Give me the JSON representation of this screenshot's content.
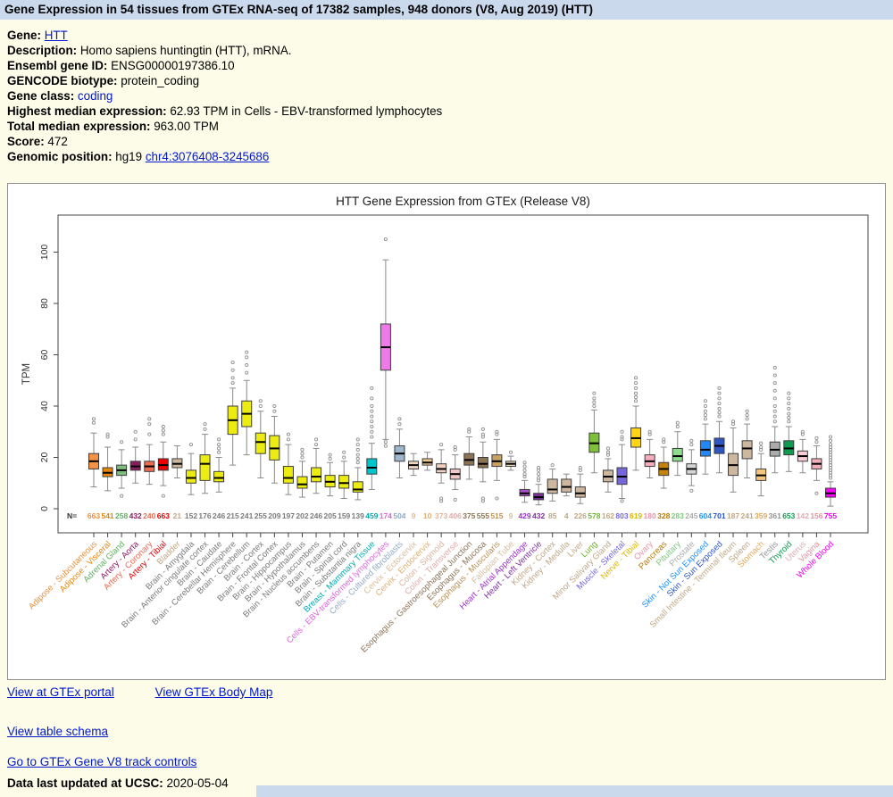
{
  "page": {
    "header": "Gene Expression in 54 tissues from GTEx RNA-seq of 17382 samples, 948 donors (V8, Aug 2019) (HTT)"
  },
  "info": {
    "rows": [
      {
        "label": "Gene:",
        "link": "HTT"
      },
      {
        "label": "Description:",
        "value": "Homo sapiens huntingtin (HTT), mRNA."
      },
      {
        "label": "Ensembl gene ID:",
        "value": "ENSG00000197386.10"
      },
      {
        "label": "GENCODE biotype:",
        "value": "protein_coding"
      },
      {
        "label": "Gene class:",
        "link": "coding"
      },
      {
        "label": "Highest median expression:",
        "value": "62.93 TPM in Cells - EBV-transformed lymphocytes"
      },
      {
        "label": "Total median expression:",
        "value": "963.00 TPM"
      },
      {
        "label": "Score:",
        "value": "472"
      },
      {
        "label": "Genomic position:",
        "value": "hg19",
        "link": "chr4:3076408-3245686"
      }
    ]
  },
  "links": {
    "portal": "View at GTEx portal",
    "bodymap": "View GTEx Body Map",
    "schema": "View table schema",
    "controls": "Go to GTEx Gene V8 track controls"
  },
  "footer": {
    "label": "Data last updated at UCSC:",
    "value": "2020-05-04"
  },
  "chart_data": {
    "type": "boxplot",
    "title": "HTT Gene Expression from GTEx (Release V8)",
    "ylabel": "TPM",
    "yticks": [
      0,
      20,
      40,
      60,
      80,
      100
    ],
    "ylim": [
      0,
      110
    ],
    "n_label": "N=",
    "brain_label_color": "#7a7a7a",
    "tissues": [
      {
        "name": "Adipose - Subcutaneous",
        "n": 663,
        "color": "#f59245",
        "label_color": "#e8903f",
        "q1": 15.5,
        "median": 18.5,
        "q3": 21.5,
        "wlow": 8.5,
        "whigh": 29.5,
        "outliers": [
          33.5,
          35
        ]
      },
      {
        "name": "Adipose - Visceral",
        "n": 541,
        "color": "#e7860e",
        "label_color": "#e7860e",
        "q1": 12.5,
        "median": 14,
        "q3": 16,
        "wlow": 7,
        "whigh": 24,
        "outliers": [
          28,
          29
        ]
      },
      {
        "name": "Adrenal Gland",
        "n": 258,
        "color": "#7ebe7e",
        "label_color": "#5fae5f",
        "q1": 13,
        "median": 15,
        "q3": 17,
        "wlow": 8,
        "whigh": 23,
        "outliers": [
          26,
          5
        ]
      },
      {
        "name": "Artery - Aorta",
        "n": 432,
        "color": "#8b1c62",
        "label_color": "#8b1c62",
        "q1": 15,
        "median": 16.5,
        "q3": 18.5,
        "wlow": 10,
        "whigh": 24,
        "outliers": [
          27,
          30
        ]
      },
      {
        "name": "Artery - Coronary",
        "n": 240,
        "color": "#ee6a50",
        "label_color": "#ee6a50",
        "q1": 14.5,
        "median": 16.5,
        "q3": 18.5,
        "wlow": 9.5,
        "whigh": 25,
        "outliers": [
          29,
          33,
          35
        ]
      },
      {
        "name": "Artery - Tibial",
        "n": 663,
        "color": "#ee0000",
        "label_color": "#dd0000",
        "q1": 15,
        "median": 17,
        "q3": 19.5,
        "wlow": 9,
        "whigh": 26,
        "outliers": [
          29,
          30.5,
          32,
          5
        ]
      },
      {
        "name": "Bladder",
        "n": 21,
        "color": "#cdb79e",
        "label_color": "#c0a683",
        "q1": 16,
        "median": 17.5,
        "q3": 19.5,
        "wlow": 12,
        "whigh": 24.5,
        "outliers": []
      },
      {
        "name": "Brain - Amygdala",
        "n": 152,
        "color": "#ecec13",
        "label_color": "#7a7a7a",
        "q1": 10,
        "median": 12,
        "q3": 15,
        "wlow": 5.5,
        "whigh": 21.5,
        "outliers": [
          25
        ]
      },
      {
        "name": "Brain - Anterior cingulate cortex",
        "n": 176,
        "color": "#ecec13",
        "label_color": "#7a7a7a",
        "q1": 11,
        "median": 17.5,
        "q3": 21,
        "wlow": 6,
        "whigh": 29,
        "outliers": [
          31,
          33
        ]
      },
      {
        "name": "Brain - Caudate",
        "n": 246,
        "color": "#ecec13",
        "label_color": "#7a7a7a",
        "q1": 10.5,
        "median": 12,
        "q3": 14.5,
        "wlow": 6.5,
        "whigh": 20,
        "outliers": [
          22,
          23.5,
          25,
          27
        ]
      },
      {
        "name": "Brain - Cerebellar Hemisphere",
        "n": 215,
        "color": "#ecec13",
        "label_color": "#7a7a7a",
        "q1": 29,
        "median": 34.5,
        "q3": 40,
        "wlow": 17,
        "whigh": 47,
        "outliers": [
          49,
          51,
          54,
          57
        ]
      },
      {
        "name": "Brain - Cerebellum",
        "n": 241,
        "color": "#ecec13",
        "label_color": "#7a7a7a",
        "q1": 32,
        "median": 37,
        "q3": 42,
        "wlow": 21,
        "whigh": 50,
        "outliers": [
          53,
          56,
          59,
          61
        ]
      },
      {
        "name": "Brain - Cortex",
        "n": 255,
        "color": "#ecec13",
        "label_color": "#7a7a7a",
        "q1": 21.5,
        "median": 26,
        "q3": 29.5,
        "wlow": 12,
        "whigh": 38,
        "outliers": [
          40,
          42
        ]
      },
      {
        "name": "Brain - Frontal Cortex",
        "n": 209,
        "color": "#ecec13",
        "label_color": "#7a7a7a",
        "q1": 19,
        "median": 23.5,
        "q3": 28.5,
        "wlow": 10,
        "whigh": 36,
        "outliers": [
          38,
          40
        ]
      },
      {
        "name": "Brain - Hippocampus",
        "n": 197,
        "color": "#ecec13",
        "label_color": "#7a7a7a",
        "q1": 10,
        "median": 12,
        "q3": 16.5,
        "wlow": 5.5,
        "whigh": 25,
        "outliers": [
          27,
          29
        ]
      },
      {
        "name": "Brain - Hypothalamus",
        "n": 202,
        "color": "#ecec13",
        "label_color": "#7a7a7a",
        "q1": 8,
        "median": 9.5,
        "q3": 12.5,
        "wlow": 4.5,
        "whigh": 18.5,
        "outliers": [
          20,
          21.5,
          23
        ]
      },
      {
        "name": "Brain - Nucleus accumbens",
        "n": 246,
        "color": "#ecec13",
        "label_color": "#7a7a7a",
        "q1": 10.5,
        "median": 12.5,
        "q3": 16,
        "wlow": 6,
        "whigh": 23.5,
        "outliers": [
          25,
          27
        ]
      },
      {
        "name": "Brain - Putamen",
        "n": 205,
        "color": "#ecec13",
        "label_color": "#7a7a7a",
        "q1": 8.5,
        "median": 10.5,
        "q3": 13,
        "wlow": 5,
        "whigh": 18,
        "outliers": [
          19.5,
          21
        ]
      },
      {
        "name": "Brain - Spinal cord",
        "n": 159,
        "color": "#ecec13",
        "label_color": "#7a7a7a",
        "q1": 8,
        "median": 10,
        "q3": 13,
        "wlow": 4,
        "whigh": 18.5,
        "outliers": [
          20,
          22
        ]
      },
      {
        "name": "Brain - Substantia nigra",
        "n": 139,
        "color": "#ecec13",
        "label_color": "#7a7a7a",
        "q1": 6.5,
        "median": 7.5,
        "q3": 10.5,
        "wlow": 3.5,
        "whigh": 16,
        "outliers": [
          18,
          19.5,
          21,
          23,
          25,
          27
        ]
      },
      {
        "name": "Breast - Mammary Tissue",
        "n": 459,
        "color": "#00c5cd",
        "label_color": "#00aab2",
        "q1": 13.5,
        "median": 16,
        "q3": 19.5,
        "wlow": 7.5,
        "whigh": 25.5,
        "outliers": [
          28,
          30,
          32,
          34,
          36,
          38,
          40,
          43,
          47
        ]
      },
      {
        "name": "Cells - EBV-transformed lymphocytes",
        "n": 174,
        "color": "#ee7ae9",
        "label_color": "#dd66dd",
        "q1": 54,
        "median": 62.93,
        "q3": 72,
        "wlow": 27,
        "whigh": 97,
        "outliers": [
          24.5,
          26,
          105
        ]
      },
      {
        "name": "Cells - Cultured fibroblasts",
        "n": 504,
        "color": "#9fb6cd",
        "label_color": "#92aac4",
        "q1": 18.5,
        "median": 21.5,
        "q3": 24.5,
        "wlow": 12,
        "whigh": 31,
        "outliers": [
          33,
          35
        ]
      },
      {
        "name": "Cervix - Ectocervix",
        "n": 9,
        "color": "#eed7c0",
        "label_color": "#d9bc9c",
        "q1": 15.5,
        "median": 17,
        "q3": 18.5,
        "wlow": 13,
        "whigh": 21.5,
        "outliers": []
      },
      {
        "name": "Cervix - Endocervix",
        "n": 10,
        "color": "#eec591",
        "label_color": "#dfae6f",
        "q1": 17,
        "median": 18,
        "q3": 19.5,
        "wlow": 15,
        "whigh": 22,
        "outliers": []
      },
      {
        "name": "Colon - Sigmoid",
        "n": 373,
        "color": "#eed0c0",
        "label_color": "#ddb49e",
        "q1": 14,
        "median": 15.5,
        "q3": 17.5,
        "wlow": 10,
        "whigh": 23,
        "outliers": [
          25,
          4,
          3
        ]
      },
      {
        "name": "Colon - Transverse",
        "n": 406,
        "color": "#f0c8c8",
        "label_color": "#dfa9a9",
        "q1": 11.5,
        "median": 13.5,
        "q3": 15.5,
        "wlow": 7.5,
        "whigh": 21,
        "outliers": [
          23,
          24,
          3.5
        ]
      },
      {
        "name": "Esophagus - Gastroesophageal Junction",
        "n": 375,
        "color": "#8b7355",
        "label_color": "#8b7355",
        "q1": 17,
        "median": 19,
        "q3": 21.5,
        "wlow": 11.5,
        "whigh": 28,
        "outliers": [
          30,
          31
        ]
      },
      {
        "name": "Esophagus - Mucosa",
        "n": 555,
        "color": "#8b7355",
        "label_color": "#8b7355",
        "q1": 16,
        "median": 17.5,
        "q3": 20,
        "wlow": 10.5,
        "whigh": 26,
        "outliers": [
          28,
          29,
          31,
          4,
          3
        ]
      },
      {
        "name": "Esophagus - Muscularis",
        "n": 515,
        "color": "#c8a165",
        "label_color": "#bb9154",
        "q1": 16.5,
        "median": 18.5,
        "q3": 21,
        "wlow": 11,
        "whigh": 27,
        "outliers": [
          29,
          30,
          4
        ]
      },
      {
        "name": "Fallopian Tube",
        "n": 9,
        "color": "#ead5bd",
        "label_color": "#d6bd9d",
        "q1": 16.5,
        "median": 17.5,
        "q3": 18.5,
        "wlow": 15,
        "whigh": 20.5,
        "outliers": [
          22
        ]
      },
      {
        "name": "Heart - Atrial Appendage",
        "n": 429,
        "color": "#a94fc7",
        "label_color": "#9932cc",
        "q1": 5,
        "median": 6,
        "q3": 7.5,
        "wlow": 2.5,
        "whigh": 11,
        "outliers": [
          12.5,
          13.5,
          15,
          16.5,
          18
        ]
      },
      {
        "name": "Heart - Left Ventricle",
        "n": 432,
        "color": "#7d2f9b",
        "label_color": "#7d2f9b",
        "q1": 3.5,
        "median": 4.5,
        "q3": 6,
        "wlow": 1.5,
        "whigh": 9.5,
        "outliers": [
          11,
          12,
          13.5,
          15,
          16
        ]
      },
      {
        "name": "Kidney - Cortex",
        "n": 85,
        "color": "#cdb79e",
        "label_color": "#c0a683",
        "q1": 6,
        "median": 7.5,
        "q3": 11.5,
        "wlow": 3,
        "whigh": 15.5,
        "outliers": [
          17
        ]
      },
      {
        "name": "Kidney - Medulla",
        "n": 4,
        "color": "#cdb79e",
        "label_color": "#c0a683",
        "q1": 6.5,
        "median": 8.5,
        "q3": 11.5,
        "wlow": 5,
        "whigh": 13.5,
        "outliers": []
      },
      {
        "name": "Liver",
        "n": 226,
        "color": "#cdb79e",
        "label_color": "#c0a683",
        "q1": 4.5,
        "median": 6,
        "q3": 8.5,
        "wlow": 2,
        "whigh": 13.5,
        "outliers": [
          15,
          16
        ]
      },
      {
        "name": "Lung",
        "n": 578,
        "color": "#7dc13b",
        "label_color": "#6db32d",
        "q1": 22,
        "median": 25.5,
        "q3": 29.5,
        "wlow": 14,
        "whigh": 38.5,
        "outliers": [
          40,
          41.5,
          43,
          45
        ]
      },
      {
        "name": "Minor Salivary Gland",
        "n": 162,
        "color": "#cdb79e",
        "label_color": "#c0a683",
        "q1": 10.5,
        "median": 12.5,
        "q3": 15,
        "wlow": 6.5,
        "whigh": 19.5,
        "outliers": [
          21,
          22,
          23.5
        ]
      },
      {
        "name": "Muscle - Skeletal",
        "n": 803,
        "color": "#7467db",
        "label_color": "#7467db",
        "q1": 9.5,
        "median": 12.5,
        "q3": 16,
        "wlow": 4,
        "whigh": 25,
        "outliers": [
          27,
          28,
          30,
          3
        ]
      },
      {
        "name": "Nerve - Tibial",
        "n": 619,
        "color": "#ffd514",
        "label_color": "#e0b400",
        "q1": 24,
        "median": 27.5,
        "q3": 31.5,
        "wlow": 15,
        "whigh": 40,
        "outliers": [
          42,
          43.5,
          45,
          47,
          49,
          51
        ]
      },
      {
        "name": "Ovary",
        "n": 180,
        "color": "#f6aebd",
        "label_color": "#e893a6",
        "q1": 16.5,
        "median": 18.5,
        "q3": 21,
        "wlow": 12,
        "whigh": 27,
        "outliers": [
          29,
          30
        ]
      },
      {
        "name": "Pancreas",
        "n": 328,
        "color": "#c5830a",
        "label_color": "#b67a09",
        "q1": 13,
        "median": 15.5,
        "q3": 18,
        "wlow": 8,
        "whigh": 24,
        "outliers": [
          26,
          27
        ]
      },
      {
        "name": "Pituitary",
        "n": 283,
        "color": "#8fdc8f",
        "label_color": "#7cc87c",
        "q1": 18.5,
        "median": 20.5,
        "q3": 23.5,
        "wlow": 13,
        "whigh": 30,
        "outliers": [
          32,
          33.5
        ]
      },
      {
        "name": "Prostate",
        "n": 245,
        "color": "#d4d4d4",
        "label_color": "#ababab",
        "q1": 13.5,
        "median": 15.5,
        "q3": 17.5,
        "wlow": 9,
        "whigh": 23,
        "outliers": [
          25,
          26.5,
          7
        ]
      },
      {
        "name": "Skin - Not Sun Exposed",
        "n": 604,
        "color": "#2387f5",
        "label_color": "#1e90ff",
        "q1": 20.5,
        "median": 23,
        "q3": 26.5,
        "wlow": 13.5,
        "whigh": 33,
        "outliers": [
          35,
          36.5,
          38,
          40,
          42
        ]
      },
      {
        "name": "Skin - Sun Exposed",
        "n": 701,
        "color": "#2e55c4",
        "label_color": "#2e55c4",
        "q1": 21.5,
        "median": 24.5,
        "q3": 27.5,
        "wlow": 14,
        "whigh": 34,
        "outliers": [
          36,
          37.5,
          39,
          41,
          43,
          45,
          47
        ]
      },
      {
        "name": "Small Intestine - Terminal Ileum",
        "n": 187,
        "color": "#cdb79e",
        "label_color": "#c0a683",
        "q1": 13,
        "median": 17,
        "q3": 21.5,
        "wlow": 6.5,
        "whigh": 31.5,
        "outliers": [
          33,
          34
        ]
      },
      {
        "name": "Spleen",
        "n": 241,
        "color": "#cdb79e",
        "label_color": "#c0a683",
        "q1": 19.5,
        "median": 23.5,
        "q3": 26.5,
        "wlow": 12,
        "whigh": 33,
        "outliers": [
          35,
          36.5,
          38
        ]
      },
      {
        "name": "Stomach",
        "n": 359,
        "color": "#f6c57d",
        "label_color": "#e0a958",
        "q1": 11,
        "median": 13,
        "q3": 15.5,
        "wlow": 5,
        "whigh": 21.5,
        "outliers": [
          23,
          24,
          25.5
        ]
      },
      {
        "name": "Testis",
        "n": 361,
        "color": "#ababab",
        "label_color": "#949494",
        "q1": 20.5,
        "median": 23,
        "q3": 26,
        "wlow": 14,
        "whigh": 32,
        "outliers": [
          34,
          36,
          38,
          40,
          43,
          46,
          49,
          52,
          55
        ]
      },
      {
        "name": "Thyroid",
        "n": 653,
        "color": "#0d9b4d",
        "label_color": "#0d9b4d",
        "q1": 21,
        "median": 23.5,
        "q3": 26.5,
        "wlow": 14.5,
        "whigh": 32,
        "outliers": [
          34,
          35.5,
          37,
          39,
          41,
          43,
          45
        ]
      },
      {
        "name": "Uterus",
        "n": 142,
        "color": "#f3cdd3",
        "label_color": "#dfacb4",
        "q1": 18.5,
        "median": 20.5,
        "q3": 22.5,
        "wlow": 14,
        "whigh": 27,
        "outliers": [
          29,
          30
        ]
      },
      {
        "name": "Vagina",
        "n": 156,
        "color": "#f2aeb9",
        "label_color": "#e293a1",
        "q1": 15.5,
        "median": 17.5,
        "q3": 19.5,
        "wlow": 11,
        "whigh": 24.5,
        "outliers": [
          26,
          27.5,
          6
        ]
      },
      {
        "name": "Whole Blood",
        "n": 755,
        "color": "#ff00ff",
        "label_color": "#ee00ee",
        "q1": 4.5,
        "median": 6,
        "q3": 8,
        "wlow": 1,
        "whigh": 10.5,
        "outliers": [
          12,
          13,
          14,
          15,
          16,
          17,
          18,
          19,
          20,
          21,
          22,
          23,
          24,
          25,
          26.5,
          28
        ]
      }
    ]
  }
}
